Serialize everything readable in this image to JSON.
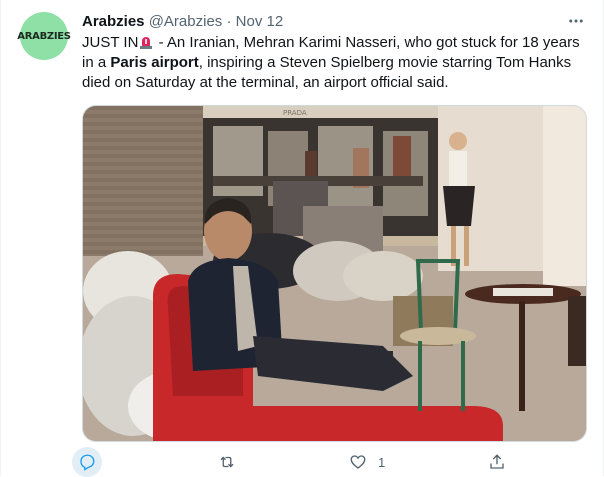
{
  "author": {
    "avatar_text": "ARABZIES",
    "name": "Arabzies",
    "handle": "@Arabzies",
    "separator": "·",
    "date": "Nov 12"
  },
  "tweet": {
    "text_prefix": "JUST IN",
    "text_part1": " - An Iranian, Mehran Karimi Nasseri, who got stuck for 18 years in a ",
    "bold_phrase": "Paris airport",
    "text_part2": ", inspiring a Steven Spielberg movie starring Tom Hanks died on Saturday at the terminal, an airport official said."
  },
  "media": {
    "sign_text": "PRADA"
  },
  "actions": {
    "reply_count": "",
    "retweet_count": "",
    "like_count": "1"
  },
  "colors": {
    "accent": "#1d9bf0",
    "avatar_bg": "#8fe0a6",
    "secondary_text": "#536471",
    "chair_red": "#c8282a"
  },
  "icons": [
    "more-icon",
    "siren-emoji-icon",
    "reply-icon",
    "retweet-icon",
    "like-icon",
    "share-icon"
  ]
}
